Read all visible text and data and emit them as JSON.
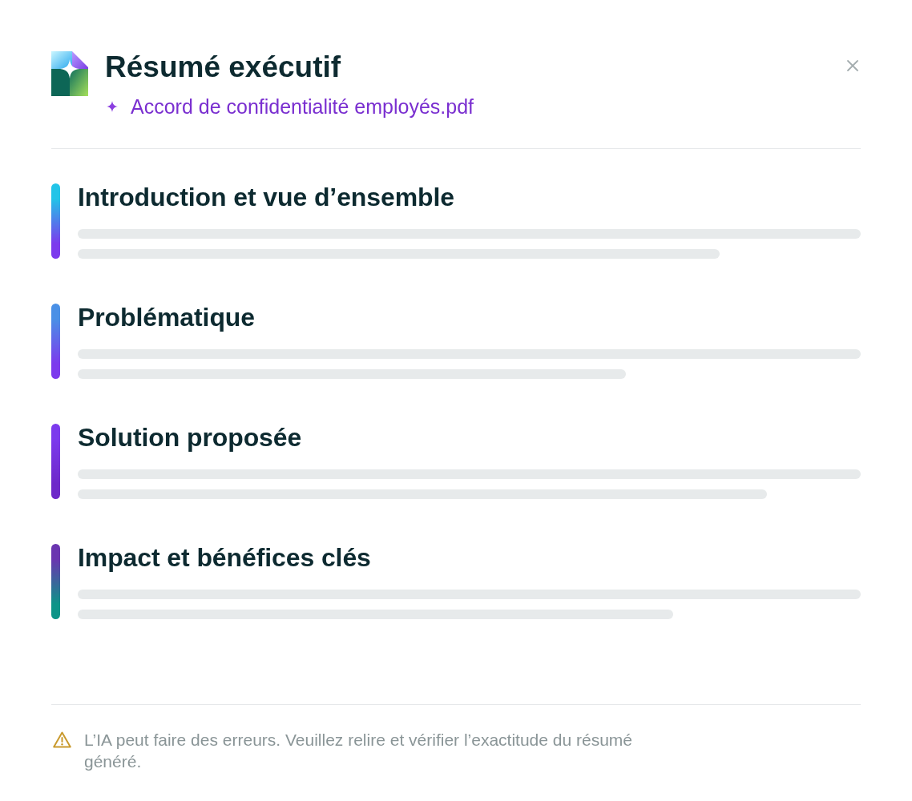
{
  "dialog": {
    "title": "Résumé exécutif",
    "document": "Accord de confidentialité employés.pdf"
  },
  "sections": [
    {
      "title": "Introduction et vue d’ensemble",
      "gradient": [
        {
          "color": "#22c4e8"
        },
        {
          "color": "#7c3aed"
        }
      ],
      "loading": true
    },
    {
      "title": "Problématique",
      "gradient": [
        {
          "color": "#4a90e6"
        },
        {
          "color": "#7c3aed"
        }
      ],
      "loading": true
    },
    {
      "title": "Solution proposée",
      "gradient": [
        {
          "color": "#7c3aed"
        },
        {
          "color": "#6d28c9"
        }
      ],
      "loading": true
    },
    {
      "title": "Impact et bénéfices clés",
      "gradient": [
        {
          "color": "#6a35b0"
        },
        {
          "color": "#0d9488"
        }
      ],
      "loading": true
    }
  ],
  "footer": {
    "notice": "L’IA peut faire des erreurs. Veuillez relire et vérifier l’exactitude du résumé généré."
  }
}
